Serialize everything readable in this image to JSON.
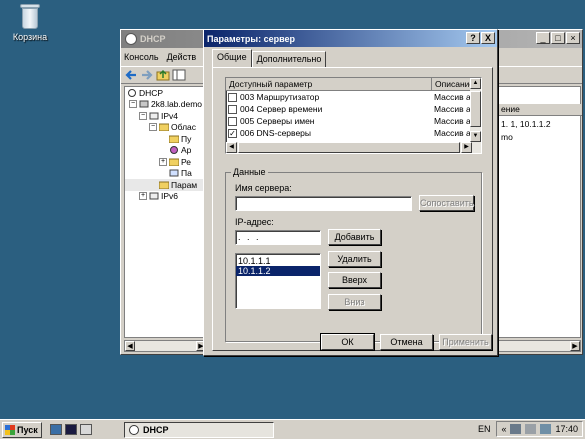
{
  "desktop": {
    "recycle_bin_label": "Корзина"
  },
  "mmc": {
    "title": "DHCP",
    "menu": [
      "Консоль",
      "Действ"
    ],
    "tree": [
      {
        "label": "DHCP",
        "level": 0
      },
      {
        "label": "2k8.lab.demo",
        "level": 1
      },
      {
        "label": "IPv4",
        "level": 2
      },
      {
        "label": "Облас",
        "level": 3
      },
      {
        "label": "Пу",
        "level": 4
      },
      {
        "label": "Ар",
        "level": 4
      },
      {
        "label": "Ре",
        "level": 4
      },
      {
        "label": "Па",
        "level": 4
      },
      {
        "label": "Парам",
        "level": 3
      },
      {
        "label": "IPv6",
        "level": 2
      }
    ],
    "right_header": "ение",
    "right_cell1": "1. 1, 10.1.1.2",
    "right_cell2": "mo"
  },
  "dialog": {
    "title": "Параметры: сервер",
    "help_button": "?",
    "close_button": "X",
    "tabs": [
      "Общие",
      "Дополнительно"
    ],
    "options_list": {
      "col_param": "Доступный параметр",
      "col_desc": "Описание",
      "rows": [
        {
          "label": "003 Маршрутизатор",
          "desc": "Массив а",
          "checked": false
        },
        {
          "label": "004 Сервер времени",
          "desc": "Массив а",
          "checked": false
        },
        {
          "label": "005 Серверы имен",
          "desc": "Массив а",
          "checked": false
        },
        {
          "label": "006 DNS-серверы",
          "desc": "Массив а",
          "checked": true
        }
      ]
    },
    "data_group": {
      "label": "Данные",
      "server_name_label": "Имя сервера:",
      "server_name_value": "",
      "resolve_button": "Сопоставить",
      "ip_label": "IP-адрес:",
      "ip_value": ".   .   .",
      "add_button": "Добавить",
      "remove_button": "Удалить",
      "up_button": "Вверх",
      "down_button": "Вниз",
      "ip_list": [
        "10.1.1.1",
        "10.1.1.2"
      ]
    },
    "ok_button": "ОК",
    "cancel_button": "Отмена",
    "apply_button": "Применить"
  },
  "taskbar": {
    "start_label": "Пуск",
    "task_label": "DHCP",
    "language": "EN",
    "clock": "17:40"
  }
}
